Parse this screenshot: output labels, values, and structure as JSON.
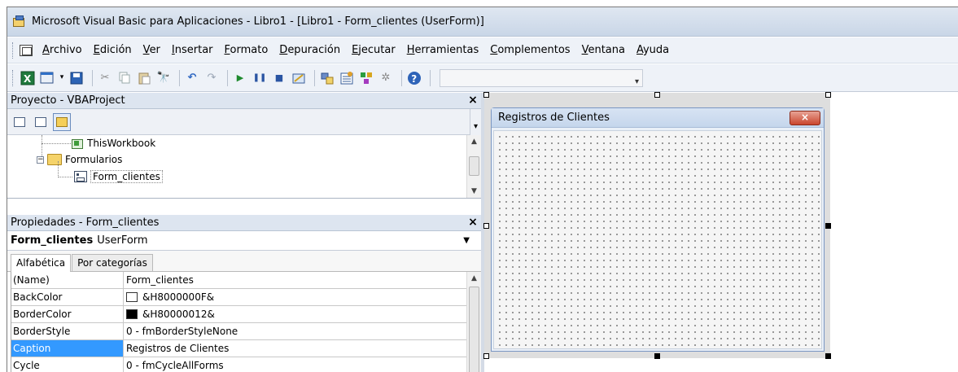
{
  "window": {
    "title": "Microsoft Visual Basic para Aplicaciones - Libro1 - [Libro1 - Form_clientes (UserForm)]"
  },
  "menu": [
    "Archivo",
    "Edición",
    "Ver",
    "Insertar",
    "Formato",
    "Depuración",
    "Ejecutar",
    "Herramientas",
    "Complementos",
    "Ventana",
    "Ayuda"
  ],
  "toolbar": {
    "icons": [
      "excel-icon",
      "insert-userform-icon",
      "save-icon",
      "cut-icon",
      "copy-icon",
      "paste-icon",
      "find-icon",
      "undo-icon",
      "redo-icon",
      "run-icon",
      "break-icon",
      "reset-icon",
      "design-mode-icon",
      "project-explorer-icon",
      "properties-icon",
      "object-browser-icon",
      "toolbox-icon",
      "help-icon"
    ]
  },
  "project": {
    "header": "Proyecto - VBAProject",
    "close": "×",
    "tree": {
      "this_workbook": "ThisWorkbook",
      "folder": "Formularios",
      "form": "Form_clientes"
    }
  },
  "properties": {
    "header": "Propiedades - Form_clientes",
    "close": "×",
    "object_name": "Form_clientes",
    "object_type": "UserForm",
    "tabs": [
      "Alfabética",
      "Por categorías"
    ],
    "rows": [
      {
        "name": "(Name)",
        "value": "Form_clientes"
      },
      {
        "name": "BackColor",
        "value": "&H8000000F&",
        "swatch": "#ffffff"
      },
      {
        "name": "BorderColor",
        "value": "&H80000012&",
        "swatch": "#000000"
      },
      {
        "name": "BorderStyle",
        "value": "0 - fmBorderStyleNone"
      },
      {
        "name": "Caption",
        "value": "Registros de Clientes"
      },
      {
        "name": "Cycle",
        "value": "0 - fmCycleAllForms"
      }
    ]
  },
  "designer": {
    "form_caption": "Registros de Clientes",
    "close_glyph": "×"
  },
  "colors": {
    "selection": "#3399ff",
    "close_button": "#c9452d"
  }
}
